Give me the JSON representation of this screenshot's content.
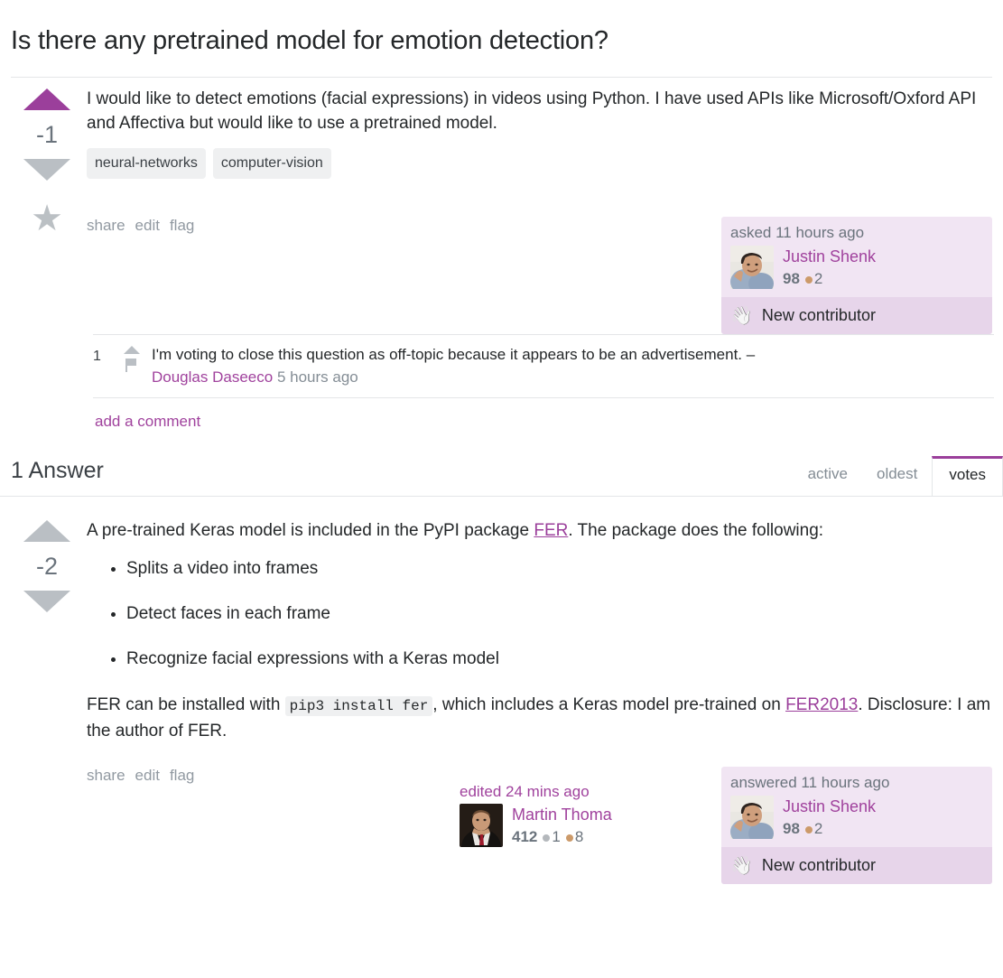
{
  "question": {
    "title": "Is there any pretrained model for emotion detection?",
    "vote_count": "-1",
    "upvote_state": "voted",
    "downvote_state": "inactive",
    "favorite_icon": "star-icon",
    "body_paragraph": "I would like to detect emotions (facial expressions) in videos using Python. I have used APIs like Microsoft/Oxford API and Affectiva but would like to use a pretrained model.",
    "tags": [
      "neural-networks",
      "computer-vision"
    ],
    "menu": {
      "share": "share",
      "edit": "edit",
      "flag": "flag"
    },
    "usercard": {
      "action": "asked 11 hours ago",
      "name": "Justin Shenk",
      "reputation": "98",
      "badges": [
        {
          "type": "bronze",
          "count": "2"
        }
      ],
      "new_contributor_label": "New contributor",
      "new_contributor_icon": "waving-hand-icon"
    },
    "comments": [
      {
        "score": "1",
        "text": "I'm voting to close this question as off-topic because it appears to be an advertisement. –",
        "author": "Douglas Daseeco",
        "time": "5 hours ago"
      }
    ],
    "add_comment_label": "add a comment"
  },
  "answers_section": {
    "heading": "1 Answer",
    "sort_tabs": [
      {
        "label": "active",
        "selected": false
      },
      {
        "label": "oldest",
        "selected": false
      },
      {
        "label": "votes",
        "selected": true
      }
    ]
  },
  "answer": {
    "vote_count": "-2",
    "upvote_state": "inactive",
    "downvote_state": "inactive",
    "intro_before_link": "A pre-trained Keras model is included in the PyPI package ",
    "intro_link": "FER",
    "intro_after_link": ". The package does the following:",
    "bullets": [
      "Splits a video into frames",
      "Detect faces in each frame",
      "Recognize facial expressions with a Keras model"
    ],
    "para2_before_code": "FER can be installed with ",
    "para2_code": "pip3 install fer",
    "para2_after_code": ", which includes a Keras model pre-trained on ",
    "para2_link": "FER2013",
    "para2_tail": ". Disclosure: I am the author of FER.",
    "menu": {
      "share": "share",
      "edit": "edit",
      "flag": "flag"
    },
    "editor": {
      "action": "edited 24 mins ago",
      "name": "Martin Thoma",
      "reputation": "412",
      "badges": [
        {
          "type": "silver",
          "count": "1"
        },
        {
          "type": "bronze",
          "count": "8"
        }
      ]
    },
    "usercard": {
      "action": "answered 11 hours ago",
      "name": "Justin Shenk",
      "reputation": "98",
      "badges": [
        {
          "type": "bronze",
          "count": "2"
        }
      ],
      "new_contributor_label": "New contributor",
      "new_contributor_icon": "waving-hand-icon"
    }
  },
  "colors": {
    "accent_purple": "#9b3f9b",
    "link_purple": "#a0429d",
    "usercard_bg": "#f1e5f3",
    "newcontrib_bg": "#e7d5ea",
    "muted": "#9199a1",
    "arrow_gray": "#babfc4"
  }
}
